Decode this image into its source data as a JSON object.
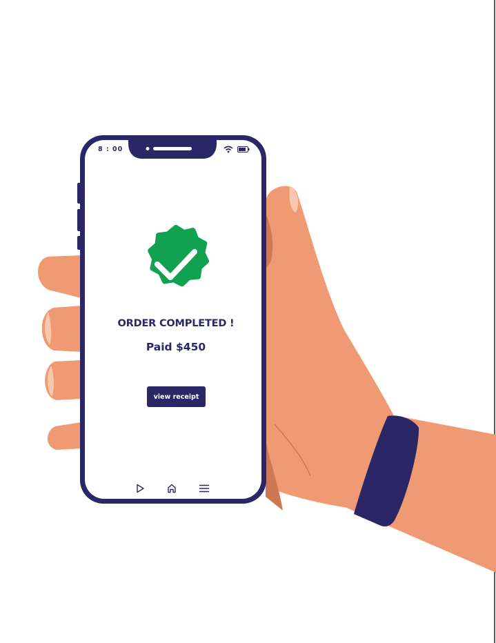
{
  "status_bar": {
    "time": "8 : 00",
    "icons": [
      "wifi-icon",
      "battery-icon"
    ]
  },
  "confirmation": {
    "badge_icon": "check-badge-icon",
    "title": "ORDER COMPLETED !",
    "amount": "Paid $450",
    "button_label": "view receipt"
  },
  "bottom_nav": {
    "items": [
      "play-icon",
      "home-icon",
      "menu-icon"
    ]
  },
  "colors": {
    "skin": "#f09a73",
    "skin_shadow": "#cf7655",
    "nail": "#f7c8ae",
    "navy": "#2b2766",
    "success_green": "#12a150",
    "white": "#ffffff"
  }
}
